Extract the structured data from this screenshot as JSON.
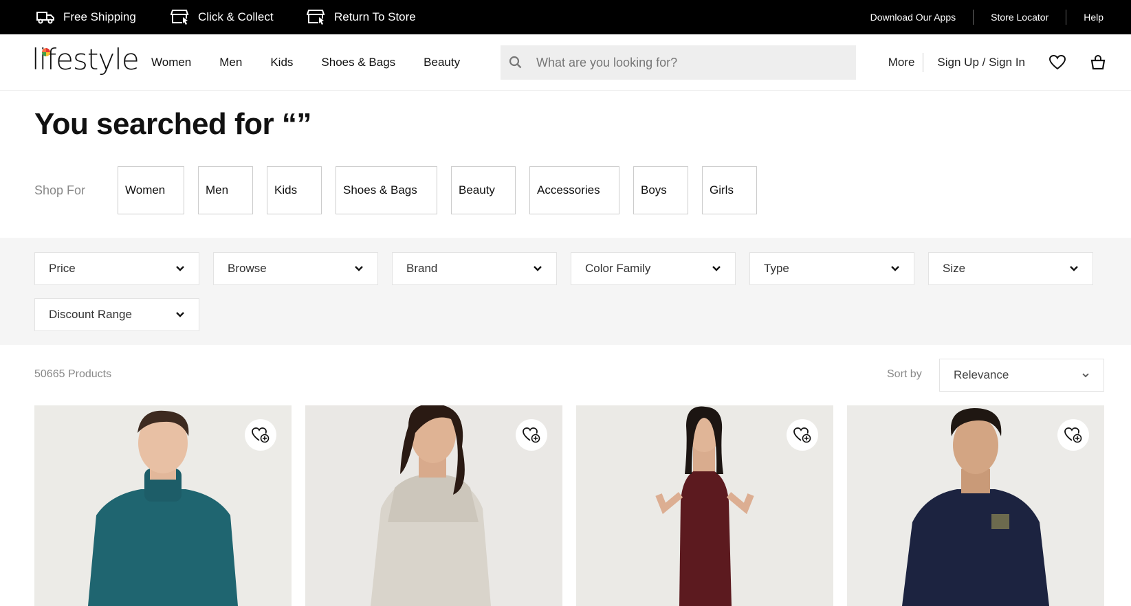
{
  "topbar": {
    "promos": [
      {
        "label": "Free Shipping",
        "icon": "truck-icon"
      },
      {
        "label": "Click & Collect",
        "icon": "store-click-icon"
      },
      {
        "label": "Return To Store",
        "icon": "store-return-icon"
      }
    ],
    "links": [
      "Download Our Apps",
      "Store Locator",
      "Help"
    ]
  },
  "header": {
    "logo": "lifestyle",
    "nav": [
      "Women",
      "Men",
      "Kids",
      "Shoes & Bags",
      "Beauty"
    ],
    "search_placeholder": "What are you looking for?",
    "more": "More",
    "signin": "Sign Up / Sign In"
  },
  "page": {
    "title": "You searched for “”",
    "shop_for_label": "Shop For",
    "shop_for": [
      "Women",
      "Men",
      "Kids",
      "Shoes & Bags",
      "Beauty",
      "Accessories",
      "Boys",
      "Girls"
    ]
  },
  "filters": [
    "Price",
    "Browse",
    "Brand",
    "Color Family",
    "Type",
    "Size",
    "Discount Range"
  ],
  "results": {
    "count": "50665 Products",
    "sort_label": "Sort by",
    "sort_value": "Relevance"
  },
  "products": [
    {
      "garment": "teal turtleneck sweater",
      "color": "#1f6570"
    },
    {
      "garment": "sequin slip dress",
      "color": "#d8d3c9"
    },
    {
      "garment": "maroon jumpsuit",
      "color": "#5c1a1f"
    },
    {
      "garment": "navy t-shirt",
      "color": "#1c2340"
    }
  ]
}
